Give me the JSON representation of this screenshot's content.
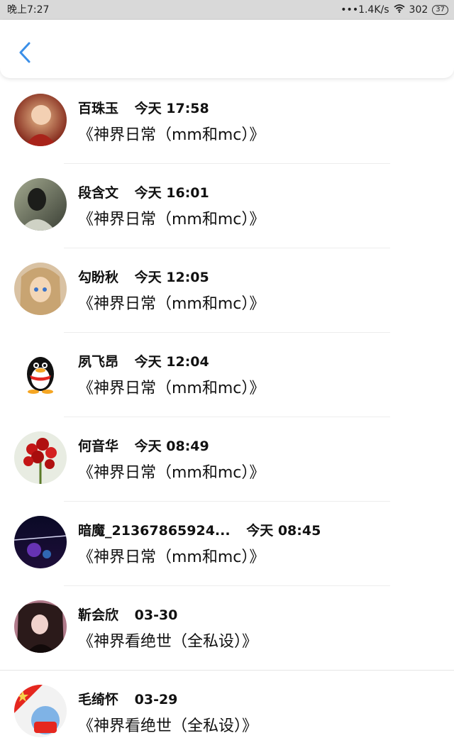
{
  "status_bar": {
    "time": "晚上7:27",
    "network": "•••1.4K/s",
    "signal": "302",
    "battery": "37"
  },
  "header": {
    "back_icon": "chevron-left-icon"
  },
  "items": [
    {
      "name": "百珠玉",
      "time": "今天 17:58",
      "work": "《神界日常（mm和mc）》",
      "avatar_colors": [
        "#7a1c12",
        "#e7b98a"
      ]
    },
    {
      "name": "段含文",
      "time": "今天 16:01",
      "work": "《神界日常（mm和mc）》",
      "avatar_colors": [
        "#3a3f35",
        "#a3a98f"
      ]
    },
    {
      "name": "勾盼秋",
      "time": "今天 12:05",
      "work": "《神界日常（mm和mc）》",
      "avatar_colors": [
        "#c8a472",
        "#f3d6b6"
      ]
    },
    {
      "name": "夙飞昂",
      "time": "今天 12:04",
      "work": "《神界日常（mm和mc）》",
      "avatar_colors": [
        "#111111",
        "#ffffff"
      ]
    },
    {
      "name": "何音华",
      "time": "今天 08:49",
      "work": "《神界日常（mm和mc）》",
      "avatar_colors": [
        "#b01010",
        "#5b7a2a"
      ]
    },
    {
      "name": "暗魔_21367865924...",
      "time": "今天 08:45",
      "work": "《神界日常（mm和mc）》",
      "avatar_colors": [
        "#0a0a26",
        "#7b3dd4"
      ]
    },
    {
      "name": "靳会欣",
      "time": "03-30",
      "work": "《神界看绝世（全私设）》",
      "avatar_colors": [
        "#2b1a1a",
        "#b07a8a"
      ]
    },
    {
      "name": "毛绮怀",
      "time": "03-29",
      "work": "《神界看绝世（全私设）》",
      "avatar_colors": [
        "#e5271f",
        "#f5d24a"
      ]
    }
  ]
}
